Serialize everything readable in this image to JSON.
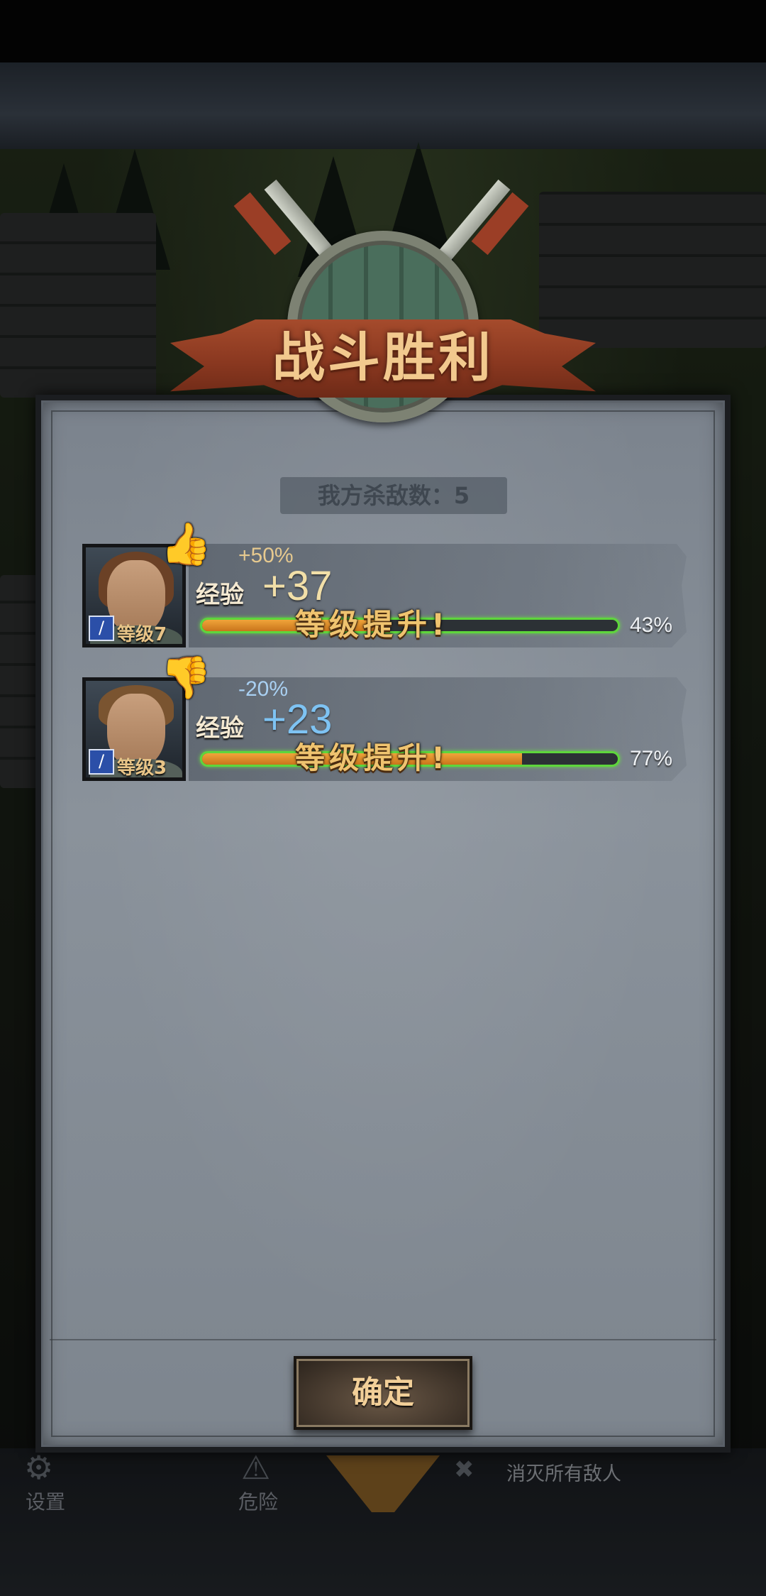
{
  "dialog": {
    "title": "战斗胜利",
    "kills_text": "我方杀敌数：5"
  },
  "heroes": [
    {
      "level_text": "等级7",
      "rating": "thumbs-up",
      "bonus": "+50%",
      "exp_label": "经验",
      "exp_value": "+37",
      "level_up_text": "等级提升!",
      "progress_percent": 43,
      "progress_text": "43%"
    },
    {
      "level_text": "等级3",
      "rating": "thumbs-down",
      "bonus": "-20%",
      "exp_label": "经验",
      "exp_value": "+23",
      "level_up_text": "等级提升!",
      "progress_percent": 77,
      "progress_text": "77%"
    }
  ],
  "confirm_label": "确定",
  "hud": {
    "settings_label": "设置",
    "danger_label": "危险",
    "objective_text": "消灭所有敌人"
  },
  "colors": {
    "bar_fill": "#e08f2c",
    "bar_glow": "#5ed63c",
    "title_text": "#f2c98e",
    "ribbon": "#8a3820"
  }
}
